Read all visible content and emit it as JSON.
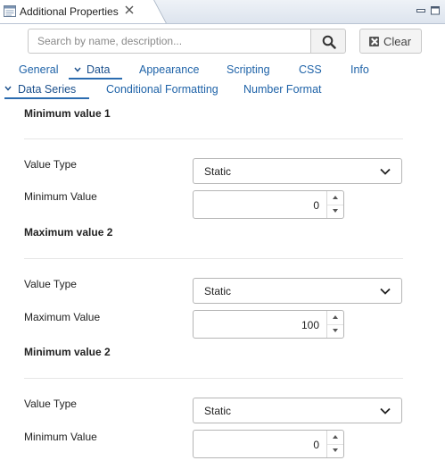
{
  "window": {
    "title": "Additional Properties"
  },
  "search": {
    "placeholder": "Search by name, description...",
    "clear_label": "Clear"
  },
  "tabs": [
    {
      "label": "General",
      "active": false
    },
    {
      "label": "Data",
      "active": true
    },
    {
      "label": "Appearance",
      "active": false
    },
    {
      "label": "Scripting",
      "active": false
    },
    {
      "label": "CSS",
      "active": false
    },
    {
      "label": "Info",
      "active": false
    }
  ],
  "subtabs": [
    {
      "label": "Data Series",
      "active": true
    },
    {
      "label": "Conditional Formatting",
      "active": false
    },
    {
      "label": "Number Format",
      "active": false
    }
  ],
  "sections": [
    {
      "title": "Minimum value 1",
      "value_type_label": "Value Type",
      "value_type": "Static",
      "value_label": "Minimum Value",
      "value": "0"
    },
    {
      "title": "Maximum value 2",
      "value_type_label": "Value Type",
      "value_type": "Static",
      "value_label": "Maximum Value",
      "value": "100"
    },
    {
      "title": "Minimum value 2",
      "value_type_label": "Value Type",
      "value_type": "Static",
      "value_label": "Minimum Value",
      "value": "0"
    }
  ],
  "colors": {
    "accent": "#2b6cb0",
    "tab_text": "#1f63a8",
    "border": "#b5b5b5"
  }
}
